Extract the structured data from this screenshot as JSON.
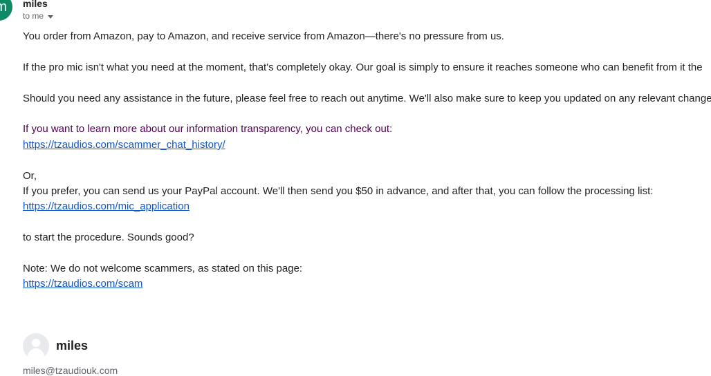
{
  "header": {
    "avatar_letter": "m",
    "sender": "miles",
    "to_label": "to me"
  },
  "message": {
    "p1": "You order from Amazon, pay to Amazon, and receive service from Amazon—there's no pressure from us.",
    "p2": "If the pro mic isn't what you need at the moment, that's completely okay. Our goal is simply to ensure it reaches someone who can benefit from it the",
    "p3": "Should you need any assistance in the future, please feel free to reach out anytime. We'll also make sure to keep you updated on any relevant change",
    "p4": "If you want to learn more about our information transparency, you can check out:",
    "link1": "https://tzaudios.com/scammer_chat_history/",
    "p5a": "Or,",
    "p5b": "If you prefer, you can send us your PayPal account. We'll then send you $50 in advance, and after that, you can follow the processing list:",
    "link2": "https://tzaudios.com/mic_application",
    "p6": "to start the procedure. Sounds good?",
    "p7": "Note: We do not welcome scammers, as stated on this page:",
    "link3": "https://tzaudios.com/scam"
  },
  "reply": {
    "sender": "miles",
    "email": "miles@tzaudiouk.com"
  },
  "colors": {
    "avatar_bg": "#0f8a66",
    "link": "#1155cc",
    "quoted_purple": "#500050"
  }
}
